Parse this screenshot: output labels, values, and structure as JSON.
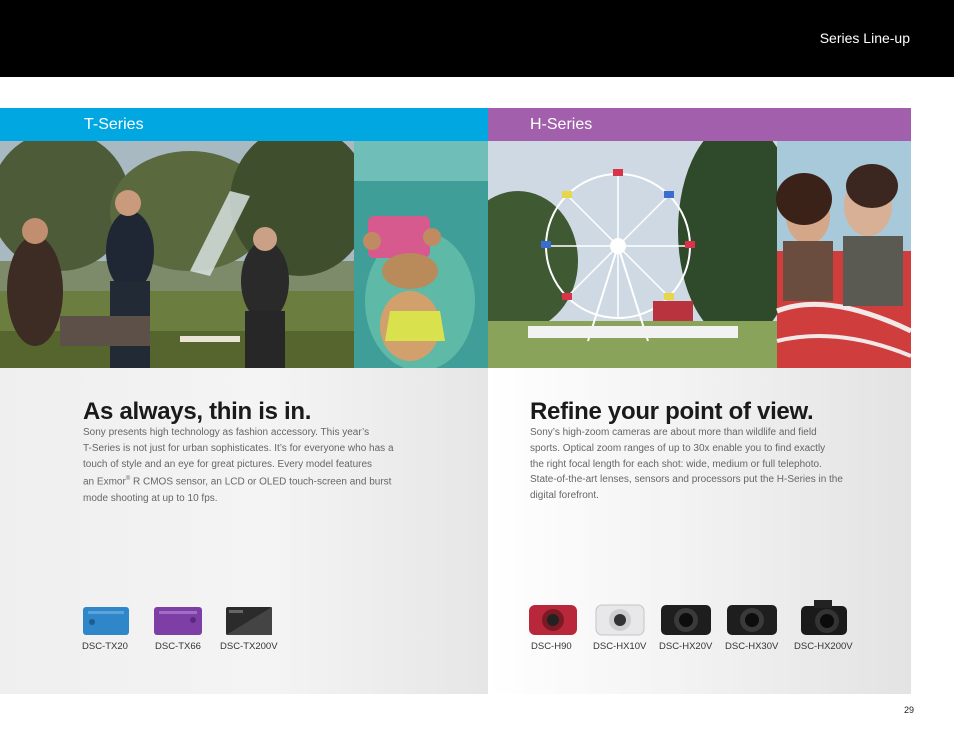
{
  "header": {
    "section_title": "Series Line-up"
  },
  "t_series": {
    "band_label": "T-Series",
    "headline": "As always, thin is in.",
    "body_lines": [
      "Sony presents high technology as fashion accessory. This year’s",
      "T-Series is not just for urban sophisticates. It’s for everyone who has a",
      "touch of style and an eye for great pictures. Every model features"
    ],
    "body_line4_pre": "an Exmor",
    "body_line4_sup": "®",
    "body_line4_post": " R CMOS sensor, an LCD or OLED touch-screen and burst",
    "body_line5": "mode shooting at up to 10 fps.",
    "models": [
      "DSC-TX20",
      "DSC-TX66",
      "DSC-TX200V"
    ],
    "camera_colors": [
      "#2f86c8",
      "#7d3fa6",
      "#2b2b2b"
    ]
  },
  "h_series": {
    "band_label": "H-Series",
    "headline": "Refine your point of view.",
    "body_lines": [
      "Sony’s high-zoom cameras are about more than wildlife and field",
      "sports. Optical zoom ranges of up to 30x enable you to find exactly",
      "the right focal length for each shot: wide, medium or full telephoto.",
      "State-of-the-art lenses, sensors and processors put the H-Series in the",
      "digital forefront."
    ],
    "models": [
      "DSC-H90",
      "DSC-HX10V",
      "DSC-HX20V",
      "DSC-HX30V",
      "DSC-HX200V"
    ],
    "camera_colors": [
      "#b8283a",
      "#e8e8ea",
      "#1e1e1e",
      "#1e1e1e",
      "#1a1a1a"
    ]
  },
  "page_number": "29",
  "colors": {
    "t_accent": "#00a7e1",
    "h_accent": "#a15fac",
    "topbar": "#000000"
  }
}
